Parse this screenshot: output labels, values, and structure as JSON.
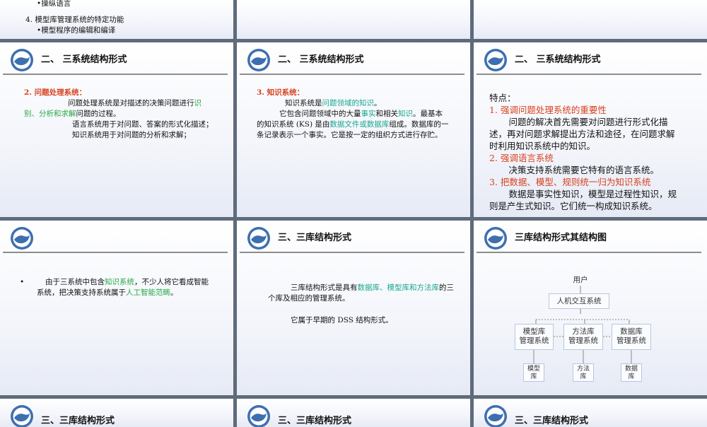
{
  "slides": {
    "s00": {
      "line1": "•操纵语言",
      "line2": "4.  模型库管理系统的特定功能",
      "line3": "•模型程序的编辑和编译"
    },
    "s10": {
      "title": "二、 三系统结构形式",
      "heading": "2.  问题处理系统：",
      "p1_a": "问题处理系统是对描述的决策问题进行",
      "p1_hl1": "识",
      "p1_hl2": "别、分析和求解",
      "p1_b": "问题的过程。",
      "p2": "语言系统用于对问题、答案的形式化描述；",
      "p3": "知识系统用于对问题的分析和求解；"
    },
    "s11": {
      "title": "二、 三系统结构形式",
      "heading": "3.  知识系统：",
      "p1_a": "知识系统是",
      "p1_hl": "问题领域的知识",
      "p1_b": "。",
      "p2_a": "它包含问题领域中的大量",
      "p2_hl1": "事实",
      "p2_b": "和相关",
      "p2_hl2": "知识",
      "p2_c": "。最基本的知识系统 (KS) 是由",
      "p2_hl3": "数据文件或数据库",
      "p2_d": "组成。数据库的一条记录表示一个事实。它是按一定的组织方式进行存贮。"
    },
    "s12": {
      "title": "二、 三系统结构形式",
      "intro": "特点：",
      "h1": "1.   强调问题处理系统的重要性",
      "t1": "问题的解决首先需要对问题进行形式化描述，再对问题求解提出方法和途径，在问题求解时利用知识系统中的知识。",
      "h2": "2.   强调语言系统",
      "t2": "决策支持系统需要它特有的语言系统。",
      "h3": "3.   把数据、模型、规则统一归为知识系统",
      "t3": "数据是事实性知识，模型是过程性知识，规则是产生式知识。它们统一构成知识系统。"
    },
    "s20": {
      "bullet": "•",
      "p_a": "由于三系统中包含",
      "p_hl1": "知识系统",
      "p_b": "，不少人将它看成智能系统，把决策支持系统属于",
      "p_hl2": "人工智能范畴",
      "p_c": "。"
    },
    "s21": {
      "title": "三、三库结构形式",
      "p1_a": "三库结构形式是具有",
      "p1_hl": "数据库、模型库和方法库",
      "p1_b": "的三个库及相应的管理系统。",
      "p2": "它属于早期的 DSS 结构形式。"
    },
    "s22": {
      "title": "三库结构形式其结构图",
      "user": "用户",
      "hci": "人机交互系统",
      "mbms_1": "模型库",
      "mbms_2": "管理系统",
      "methms_1": "方法库",
      "methms_2": "管理系统",
      "dbms_1": "数据库",
      "dbms_2": "管理系统",
      "mb_1": "模型",
      "mb_2": "库",
      "methb_1": "方法",
      "methb_2": "库",
      "db_1": "数据",
      "db_2": "库"
    },
    "s30": {
      "title": "三、三库结构形式"
    },
    "s31": {
      "title": "三、三库结构形式"
    },
    "s32": {
      "title": "三、三库结构形式"
    }
  },
  "colors": {
    "highlight_red": "#d8401e",
    "highlight_green": "#27a845",
    "highlight_teal": "#1aa68f"
  },
  "icons": {
    "logo": "university-seal-icon"
  }
}
